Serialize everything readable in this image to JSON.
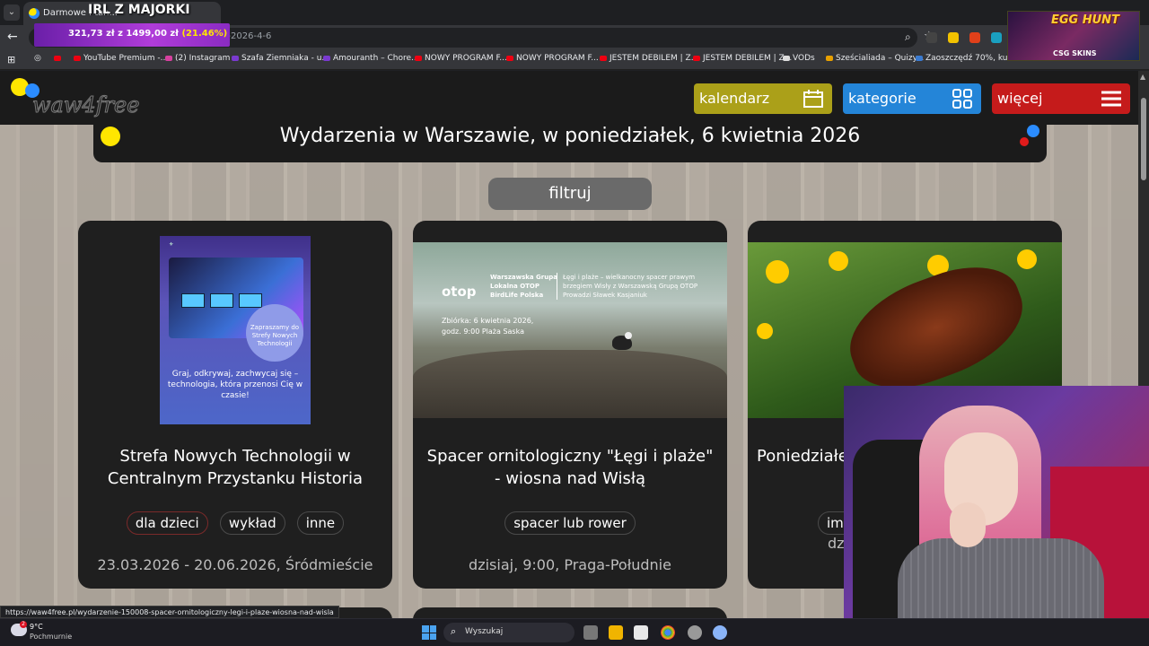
{
  "browser": {
    "tab_title": "Darmowe i tan...",
    "url": "enia-2026-4-6",
    "bookmarks": [
      "YouTube Premium -...",
      "(2) Instagram",
      "Szafa Ziemniaka - u...",
      "Amouranth – Chore...",
      "NOWY PROGRAM F...",
      "NOWY PROGRAM F...",
      "JESTEM DEBILEM | Z...",
      "JESTEM DEBILEM | Z...",
      "VODs",
      "Sześcialiada – Quizy...",
      "Zaoszczędź 70%, ku..."
    ],
    "status_url": "https://waw4free.pl/wydarzenie-150008-spacer-ornitologiczny-legi-i-plaze-wiosna-nad-wisla"
  },
  "stream": {
    "title": "IRL Z MAJORKI",
    "donation_amount": "321,73 zł",
    "donation_of": "z",
    "donation_goal": "1499,00 zł",
    "donation_percent": "(21.46%)",
    "promo_title": "EGG HUNT",
    "promo_sub": "CSG SKINS"
  },
  "site": {
    "logo_text": "waw4free",
    "nav": {
      "calendar": "kalendarz",
      "categories": "kategorie",
      "more": "więcej"
    },
    "heading": "Wydarzenia w Warszawie, w poniedziałek, 6 kwietnia 2026",
    "filter": "filtruj",
    "cards": [
      {
        "title": "Strefa Nowych Technologii w Centralnym Przystanku Historia",
        "tags": [
          "dla dzieci",
          "wykład",
          "inne"
        ],
        "meta": "23.03.2026 - 20.06.2026, Śródmieście",
        "poster": {
          "circle_text": "Zapraszamy do Strefy Nowych Technologii",
          "body": "Graj, odkrywaj, zachwycaj się – technologia, która przenosi Cię w czasie!"
        }
      },
      {
        "title": "Spacer ornitologiczny \"Łęgi i plaże\" - wiosna nad Wisłą",
        "tags": [
          "spacer lub rower"
        ],
        "meta": "dzisiaj, 9:00, Praga-Południe",
        "poster": {
          "logo": "otop",
          "org": "Warszawska Grupa Lokalna OTOP BirdLife Polska",
          "desc": "Łęgi i plaże – wielkanocny spacer prawym brzegiem Wisły z Warszawską Grupą OTOP Prowadzi Sławek Kasjaniuk",
          "when": "Zbiórka: 6 kwietnia 2026, godz. 9:00 Plaża Saska"
        }
      },
      {
        "title": "Poniedziałe",
        "tags": [
          "imp"
        ],
        "meta": "dz"
      }
    ]
  },
  "taskbar": {
    "temp": "9°C",
    "weather": "Pochmurnie",
    "search": "Wyszukaj"
  }
}
